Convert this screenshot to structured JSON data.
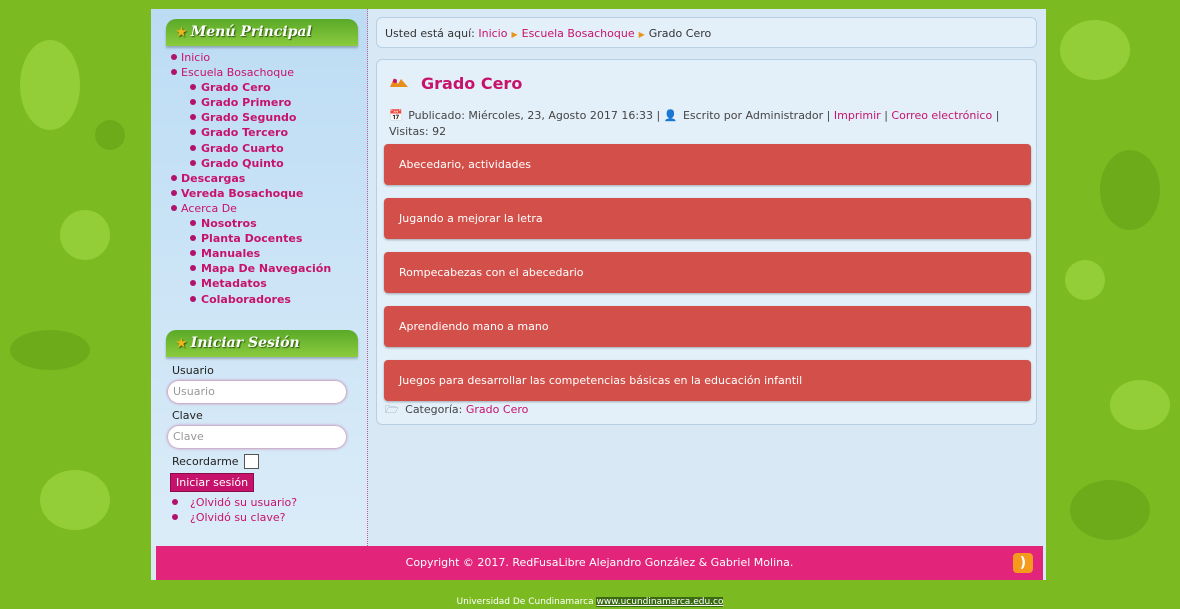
{
  "menu_principal": {
    "title": "Menú Principal",
    "items": [
      {
        "label": "Inicio"
      },
      {
        "label": "Escuela Bosachoque"
      },
      {
        "label": "Grado Cero"
      },
      {
        "label": "Grado Primero"
      },
      {
        "label": "Grado Segundo"
      },
      {
        "label": "Grado Tercero"
      },
      {
        "label": "Grado Cuarto"
      },
      {
        "label": "Grado Quinto"
      },
      {
        "label": "Descargas"
      },
      {
        "label": "Vereda Bosachoque"
      },
      {
        "label": "Acerca De"
      },
      {
        "label": "Nosotros"
      },
      {
        "label": "Planta Docentes"
      },
      {
        "label": "Manuales"
      },
      {
        "label": "Mapa De Navegación"
      },
      {
        "label": "Metadatos"
      },
      {
        "label": "Colaboradores"
      }
    ]
  },
  "login": {
    "title": "Iniciar Sesión",
    "user_label": "Usuario",
    "user_placeholder": "Usuario",
    "pass_label": "Clave",
    "pass_placeholder": "Clave",
    "remember_label": "Recordarme",
    "submit_label": "Iniciar sesión",
    "forgot_user": "¿Olvidó su usuario?",
    "forgot_pass": "¿Olvidó su clave?"
  },
  "breadcrumb": {
    "prefix": "Usted está aquí:",
    "items": [
      "Inicio",
      "Escuela Bosachoque",
      "Grado Cero"
    ]
  },
  "article": {
    "title": "Grado Cero",
    "published": "Publicado: Miércoles, 23, Agosto 2017 16:33 |",
    "author": "Escrito por Administrador |",
    "print": "Imprimir",
    "sep1": "|",
    "email": "Correo electrónico",
    "sep2": "|",
    "visits": "Visitas: 92",
    "links": [
      "Abecedario, actividades",
      "Jugando a mejorar la letra",
      "Rompecabezas con el abecedario",
      "Aprendiendo mano a mano",
      "Juegos para desarrollar las competencias básicas en la educación infantil"
    ],
    "category_label": "Categoría:",
    "category_value": "Grado Cero"
  },
  "footer": {
    "copyright": "Copyright © 2017. RedFusaLibre Alejandro González & Gabriel Molina.",
    "credit_text": "Universidad De Cundinamarca",
    "credit_link": "www.ucundinamarca.edu.co"
  },
  "colors": {
    "background": "#7cba22",
    "accent": "#c7126b",
    "link_bar": "#d3504a",
    "footer": "#e2247a"
  }
}
